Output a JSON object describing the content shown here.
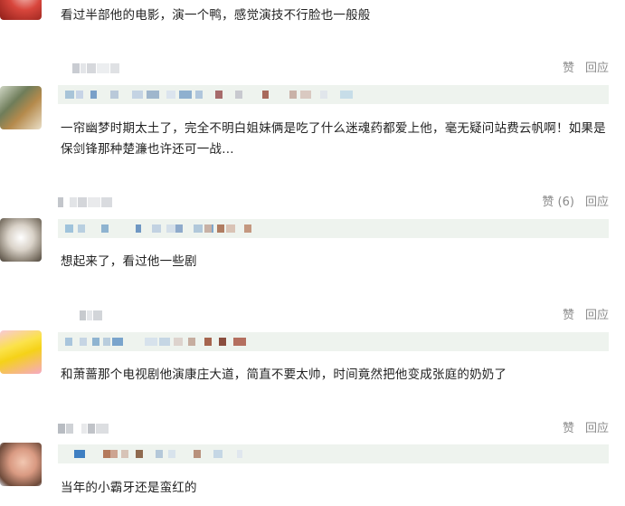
{
  "comments": [
    {
      "text": "看过半部他的电影，演一个鸭，感觉演技不行脸也一般般",
      "has_actions": false,
      "like_label": "",
      "reply_label": ""
    },
    {
      "text": "一帘幽梦时期太土了，完全不明白姐妹俩是吃了什么迷魂药都爱上他，毫无疑问站费云帆啊！如果是保剑锋那种楚濂也许还可一战…",
      "has_actions": true,
      "like_label": "赞",
      "reply_label": "回应"
    },
    {
      "text": "想起来了，看过他一些剧",
      "has_actions": true,
      "like_label": "赞 (6)",
      "reply_label": "回应"
    },
    {
      "text": "和萧蔷那个电视剧他演康庄大道，简直不要太帅，时间竟然把他变成张庭的奶奶了",
      "has_actions": true,
      "like_label": "赞",
      "reply_label": "回应"
    },
    {
      "text": "当年的小霸牙还是蛮红的",
      "has_actions": true,
      "like_label": "赞",
      "reply_label": "回应"
    }
  ],
  "colors": {
    "text": "#222222",
    "action": "#8b8b8b",
    "quote_background": "#eef3ee"
  }
}
